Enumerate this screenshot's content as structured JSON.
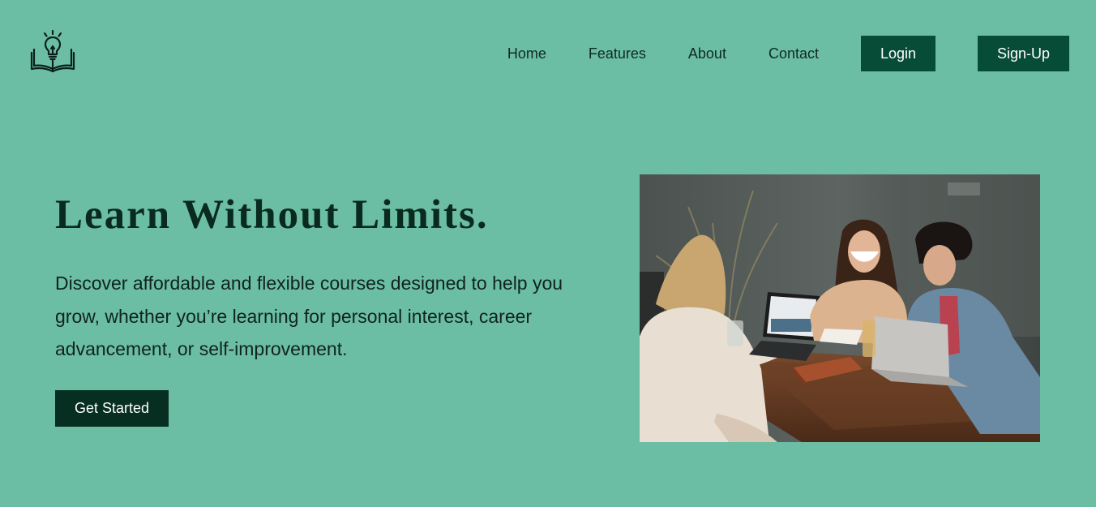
{
  "brand": {
    "logo_icon": "lightbulb-book-icon"
  },
  "nav": {
    "links": [
      "Home",
      "Features",
      "About",
      "Contact"
    ],
    "login_label": "Login",
    "signup_label": "Sign-Up"
  },
  "hero": {
    "title": "Learn Without Limits.",
    "description": "Discover affordable and flexible courses designed to help you grow, whether you’re learning for personal interest, career advancement, or self-improvement.",
    "cta_label": "Get Started",
    "image_icon": "students-studying-photo"
  },
  "colors": {
    "background": "#6bbea3",
    "nav_button": "#074c36",
    "cta_button": "#062e21",
    "title_text": "#0a2a1f"
  }
}
